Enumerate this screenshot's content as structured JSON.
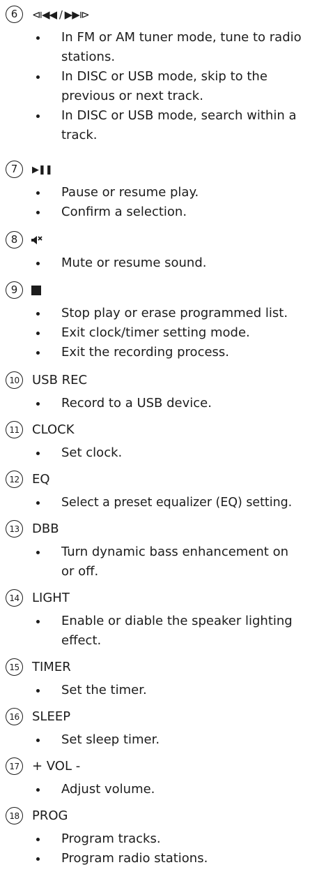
{
  "items": [
    {
      "num": "6",
      "label": "⧏◀◀ / ▶▶⧐",
      "bullets": [
        "In FM or AM tuner mode, tune to radio stations.",
        "In DISC or USB mode, skip to the previous or next track.",
        "In DISC or USB mode, search within a track."
      ]
    },
    {
      "num": "7",
      "label": "▶❚❚",
      "bullets": [
        "Pause or resume play.",
        "Confirm a selection."
      ]
    },
    {
      "num": "8",
      "label": "",
      "icon": "mute-icon",
      "bullets": [
        "Mute or resume sound."
      ]
    },
    {
      "num": "9",
      "label": "",
      "icon": "stop-square-icon",
      "bullets": [
        "Stop play or erase programmed list.",
        "Exit clock/timer setting mode.",
        "Exit the recording process."
      ]
    },
    {
      "num": "10",
      "label": "USB REC",
      "bullets": [
        "Record to a USB device."
      ]
    },
    {
      "num": "11",
      "label": "CLOCK",
      "bullets": [
        "Set clock."
      ]
    },
    {
      "num": "12",
      "label": "EQ",
      "bullets": [
        "Select a preset equalizer (EQ) setting."
      ]
    },
    {
      "num": "13",
      "label": "DBB",
      "bullets": [
        "Turn dynamic bass enhancement on or off."
      ]
    },
    {
      "num": "14",
      "label": "LIGHT",
      "bullets": [
        "Enable or diable the speaker lighting effect."
      ]
    },
    {
      "num": "15",
      "label": "TIMER",
      "bullets": [
        "Set the timer."
      ]
    },
    {
      "num": "16",
      "label": "SLEEP",
      "bullets": [
        "Set sleep timer."
      ]
    },
    {
      "num": "17",
      "label": "+ VOL -",
      "bullets": [
        "Adjust volume."
      ]
    },
    {
      "num": "18",
      "label": "PROG",
      "bullets": [
        "Program tracks.",
        "Program radio stations."
      ]
    }
  ]
}
